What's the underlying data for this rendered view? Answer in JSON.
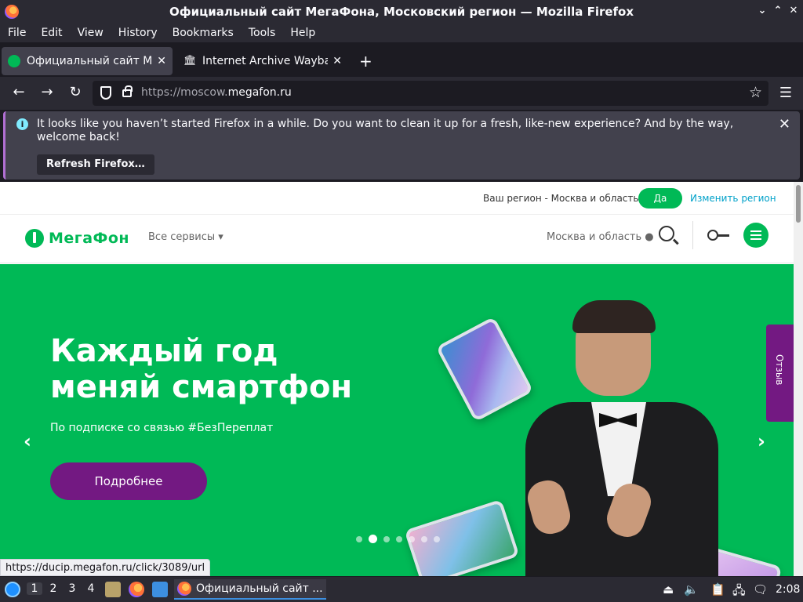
{
  "window": {
    "title": "Официальный сайт МегаФона, Московский регион — Mozilla Firefox"
  },
  "menu": [
    "File",
    "Edit",
    "View",
    "History",
    "Bookmarks",
    "Tools",
    "Help"
  ],
  "tabs": [
    {
      "label": "Официальный сайт МегаФона, Московский регион",
      "active": true
    },
    {
      "label": "Internet Archive Wayback Machine",
      "active": false
    }
  ],
  "url": {
    "prefix": "https://moscow.",
    "domain": "megafon.ru"
  },
  "notification": {
    "message": "It looks like you haven’t started Firefox in a while. Do you want to clean it up for a fresh, like-new experience? And by the way, welcome back!",
    "button": "Refresh Firefox…"
  },
  "site": {
    "region_question": "Ваш регион - Москва и область?",
    "region_yes": "Да",
    "region_change": "Изменить регион",
    "logo_text": "МегаФон",
    "services": "Все сервисы ▾",
    "city": "Москва и область ●",
    "hero": {
      "headline": "Каждый год меняй смартфон",
      "subtitle": "По подписке со связью #БезПереплат",
      "cta": "Подробнее",
      "prev": "‹",
      "next": "›",
      "slide_count": 7,
      "active_slide": 2
    },
    "feedback": "Отзыв"
  },
  "status_url": "https://ducip.megafon.ru/click/3089/url",
  "taskbar": {
    "workspaces": [
      "1",
      "2",
      "3",
      "4"
    ],
    "active_workspace": "1",
    "task_label": "Официальный сайт ...",
    "clock": "2:08"
  },
  "colors": {
    "brand_green": "#00b956",
    "brand_purple": "#731982"
  }
}
